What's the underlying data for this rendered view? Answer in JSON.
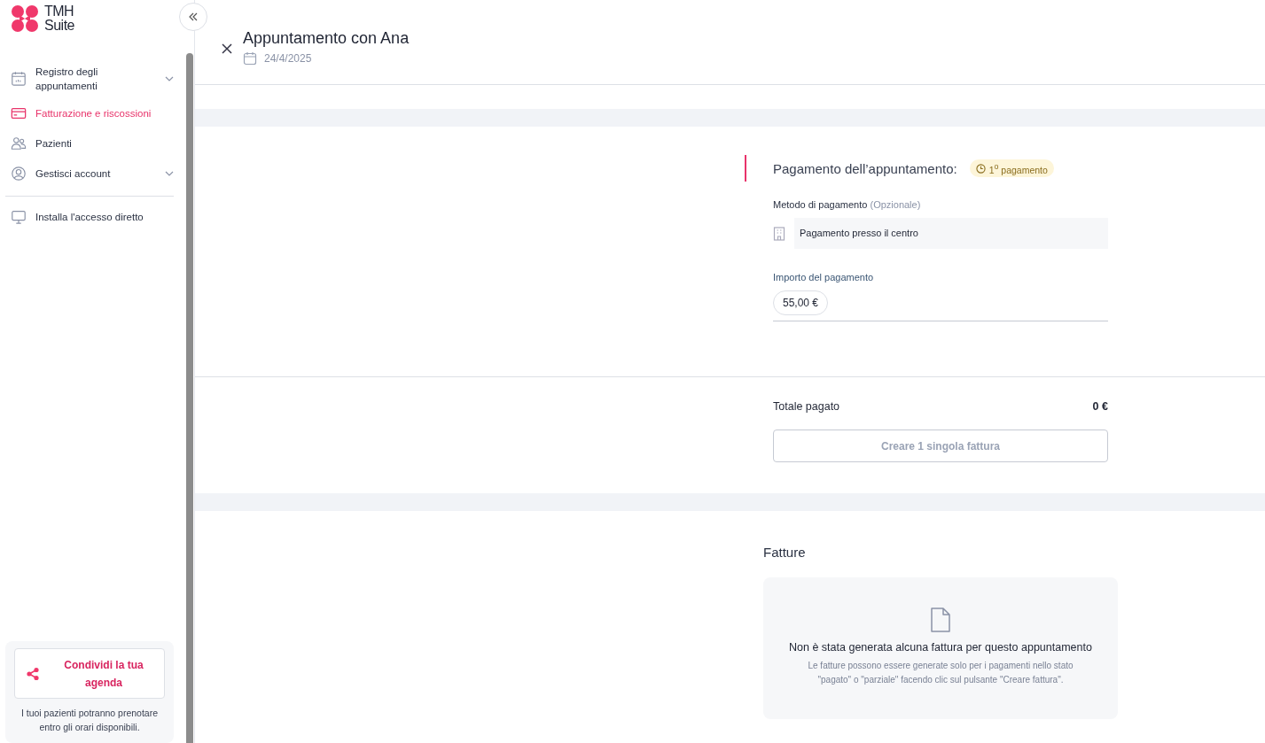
{
  "logo": {
    "line1": "TMH",
    "line2": "Suite"
  },
  "sidebar": {
    "items": [
      {
        "kind": "calendar",
        "label": "Registro degli appuntamenti",
        "selected": false,
        "expandable": true
      },
      {
        "kind": "card",
        "label": "Fatturazione e riscossioni",
        "selected": true,
        "expandable": false
      },
      {
        "kind": "people",
        "label": "Pazienti",
        "selected": false,
        "expandable": false
      },
      {
        "kind": "user",
        "label": "Gestisci account",
        "selected": false,
        "expandable": true
      }
    ],
    "extra_items": [
      {
        "kind": "monitor",
        "label": "Installa l'accesso diretto",
        "selected": false,
        "expandable": false
      }
    ],
    "share": {
      "button": "Condividi la tua agenda",
      "note": "I tuoi pazienti potranno prenotare entro gli orari disponibili."
    }
  },
  "header": {
    "title": "Appuntamento con Ana",
    "date": "24/4/2025"
  },
  "payment": {
    "title": "Pagamento dell’appuntamento:",
    "badge": "1$^{o}$ pagamento",
    "method_label": "Metodo di pagamento",
    "method_hint": "(Opzionale)",
    "method_value": "Pagamento presso il centro",
    "amount_label": "Importo del pagamento",
    "amount_value": "55,00 €"
  },
  "summary": {
    "label": "Totale pagato",
    "value": "0 €",
    "button": {
      "label": "Creare 1 singola fattura",
      "disabled": true
    }
  },
  "invoices": {
    "title": "Fatture",
    "empty_title": "Non è stata generata alcuna fattura per questo appuntamento",
    "empty_text": "Le fatture possono essere generate solo per i pagamenti nello stato \"pagato\" o \"parziale\" facendo clic sul pulsante \"Creare fattura\"."
  }
}
